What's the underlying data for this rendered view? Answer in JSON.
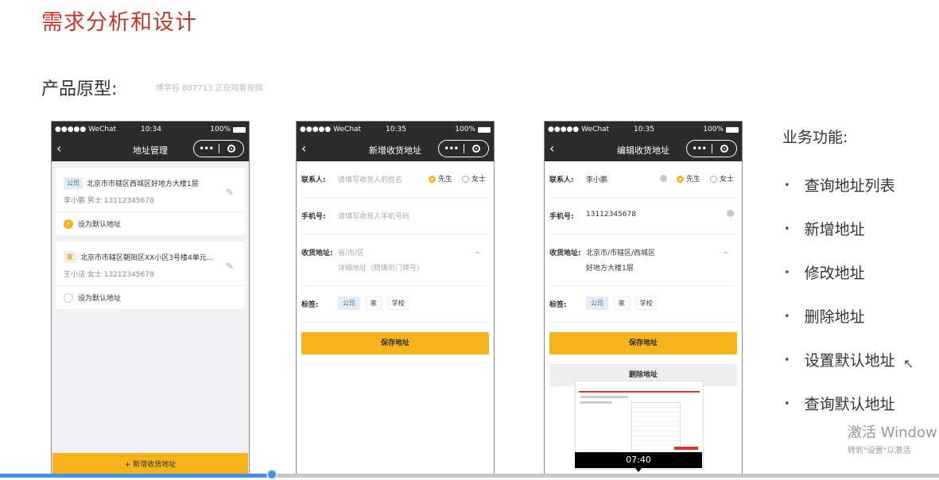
{
  "slide": {
    "title": "需求分析和设计",
    "prototype_label": "产品原型:",
    "watermark": "博学谷 887713 正在观看视频"
  },
  "phone_common": {
    "carrier": "●●●●● WeChat",
    "battery": "100%",
    "back": "‹",
    "capsule_dots": "•••"
  },
  "phone1": {
    "time": "10:34",
    "title": "地址管理",
    "addresses": [
      {
        "tag": "公司",
        "address": "北京市市辖区西城区好地方大楼1层",
        "contact": "李小鹏 男士  13112345678",
        "default_label": "设为默认地址",
        "is_default": true
      },
      {
        "tag": "家",
        "address": "北京市市辖区朝阳区XX小区3号楼4单元...",
        "contact": "王小诘 女士  13212345678",
        "default_label": "设为默认地址",
        "is_default": false
      }
    ],
    "add_button": "+ 新增收货地址"
  },
  "phone2": {
    "time": "10:35",
    "title": "新增收货地址",
    "contact_label": "联系人:",
    "contact_placeholder": "请填写收货人的姓名",
    "gender_male": "先生",
    "gender_female": "女士",
    "phone_label": "手机号:",
    "phone_placeholder": "请填写收货人手机号码",
    "addr_label": "收货地址:",
    "addr_placeholder": "省/市/区",
    "detail_placeholder": "详细地址（精确到门牌号)",
    "tag_label": "标签:",
    "tags": [
      "公司",
      "家",
      "学校"
    ],
    "save_button": "保存地址"
  },
  "phone3": {
    "time": "10:35",
    "title": "编辑收货地址",
    "contact_label": "联系人:",
    "contact_value": "李小鹏",
    "gender_male": "先生",
    "gender_female": "女士",
    "phone_label": "手机号:",
    "phone_value": "13112345678",
    "addr_label": "收货地址:",
    "addr_value": "北京市/市辖区/西城区",
    "detail_value": "好地方大楼1层",
    "tag_label": "标签:",
    "tags": [
      "公司",
      "家",
      "学校"
    ],
    "save_button": "保存地址",
    "delete_button": "删除地址",
    "video_time": "07:40"
  },
  "business": {
    "title": "业务功能:",
    "items": [
      "查询地址列表",
      "新增地址",
      "修改地址",
      "删除地址",
      "设置默认地址",
      "查询默认地址"
    ]
  },
  "activation": {
    "line1": "激活 Window",
    "line2": "转到\"设置\"以激活"
  },
  "player": {
    "progress_fraction": 0.29
  },
  "colors": {
    "title_red": "#c0392b",
    "accent_yellow": "#f6b31b",
    "dark_bar": "#2b2b2b",
    "progress_blue": "#4a90e2"
  }
}
